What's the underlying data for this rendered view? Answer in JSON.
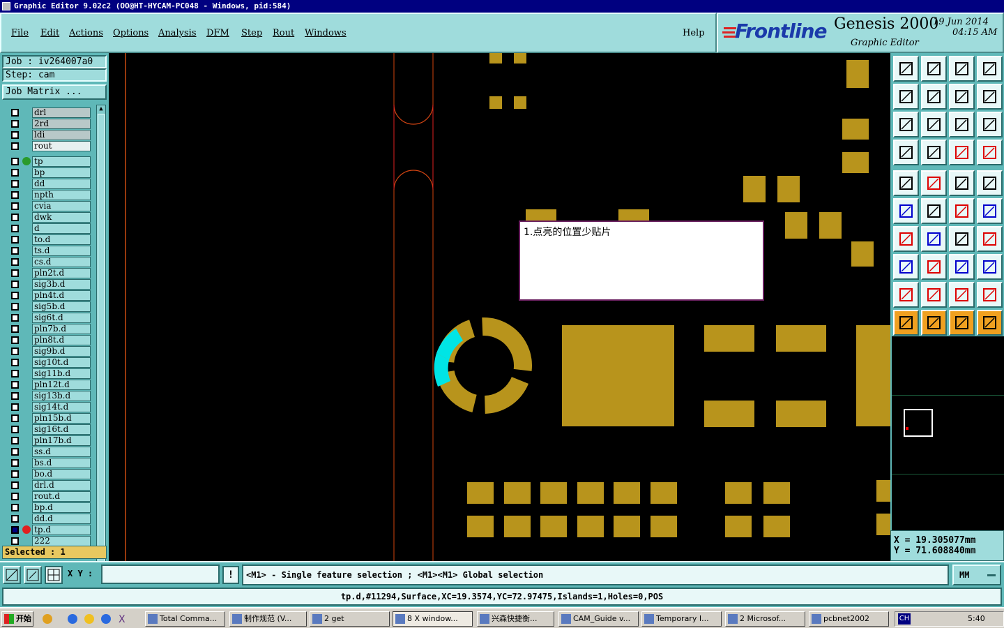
{
  "window": {
    "title": "Graphic Editor 9.02c2  (OO@HT-HYCAM-PC048 - Windows, pid:584)"
  },
  "menu": {
    "items": [
      "File",
      "Edit",
      "Actions",
      "Options",
      "Analysis",
      "DFM",
      "Step",
      "Rout",
      "Windows"
    ],
    "help": "Help"
  },
  "logo": {
    "brand": "Frontline",
    "product": "Genesis 2000",
    "subtitle": "Graphic Editor",
    "date": "19 Jun 2014",
    "time": "04:15 AM"
  },
  "sidebar": {
    "job": "Job : iv264007a0",
    "step": "Step: cam",
    "job_matrix": "Job Matrix ...",
    "layers_top": [
      "drl",
      "2rd",
      "ldi",
      "rout"
    ],
    "layers": [
      "tp",
      "bp",
      "dd",
      "npth",
      "cvia",
      "dwk",
      "d",
      "to.d",
      "ts.d",
      "cs.d",
      "pln2t.d",
      "sig3b.d",
      "pln4t.d",
      "sig5b.d",
      "sig6t.d",
      "pln7b.d",
      "pln8t.d",
      "sig9b.d",
      "sig10t.d",
      "sig11b.d",
      "pln12t.d",
      "sig13b.d",
      "sig14t.d",
      "pln15b.d",
      "sig16t.d",
      "pln17b.d",
      "ss.d",
      "bs.d",
      "bo.d",
      "drl.d",
      "rout.d",
      "bp.d",
      "dd.d",
      "tp.d",
      "222"
    ],
    "selected": "Selected : 1"
  },
  "note": {
    "text": "1.点亮的位置少贴片"
  },
  "coords": {
    "x": "X =  19.305077mm",
    "y": "Y =  71.608840mm"
  },
  "bottom": {
    "xy_label": "X Y :",
    "xy_value": "",
    "hint": "<M1> - Single feature selection ; <M1><M1> Global selection",
    "units": "MM"
  },
  "status": {
    "text": "tp.d,#11294,Surface,XC=19.3574,YC=72.97475,Islands=1,Holes=0,POS"
  },
  "taskbar": {
    "start": "开始",
    "tasks": [
      "Total Comma...",
      "制作规范 (V...",
      "2 get",
      "8 X window...",
      "兴森快捷衡...",
      "CAM_Guide v...",
      "Temporary I...",
      "2 Microsof...",
      "pcbnet2002"
    ],
    "lang": "CH",
    "clock": "5:40"
  },
  "colors": {
    "copper": "#b8941c",
    "highlight": "#00e5e5",
    "panel": "#9fdcdc",
    "teal": "#5fb8b8"
  }
}
